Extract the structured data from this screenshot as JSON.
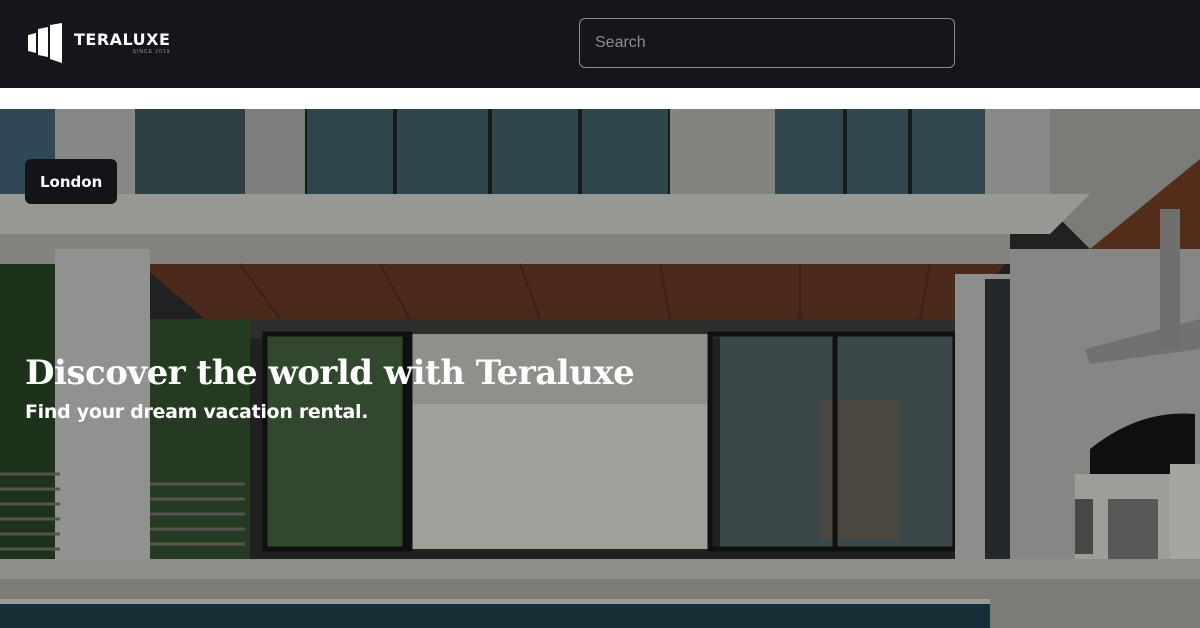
{
  "header": {
    "brand_name": "TERALUXE",
    "brand_tagline": "SINCE 2019",
    "search_placeholder": "Search",
    "search_value": ""
  },
  "hero": {
    "location_badge": "London",
    "title": "Discover the world with Teraluxe",
    "subtitle": "Find your dream vacation rental."
  },
  "colors": {
    "header_bg": "#16151b",
    "badge_bg": "#141318",
    "text_light": "#ffffff"
  }
}
